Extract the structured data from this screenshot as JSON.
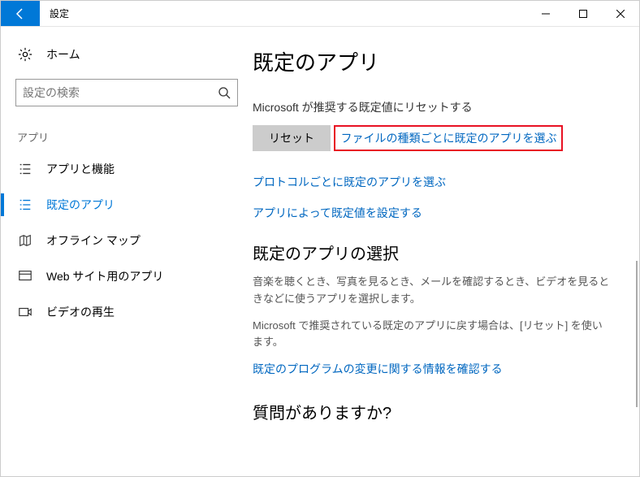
{
  "window": {
    "title": "設定"
  },
  "sidebar": {
    "home": "ホーム",
    "search_placeholder": "設定の検索",
    "section": "アプリ",
    "items": [
      {
        "label": "アプリと機能"
      },
      {
        "label": "既定のアプリ"
      },
      {
        "label": "オフライン マップ"
      },
      {
        "label": "Web サイト用のアプリ"
      },
      {
        "label": "ビデオの再生"
      }
    ]
  },
  "main": {
    "heading": "既定のアプリ",
    "reset_text": "Microsoft が推奨する既定値にリセットする",
    "reset_button": "リセット",
    "links": [
      "ファイルの種類ごとに既定のアプリを選ぶ",
      "プロトコルごとに既定のアプリを選ぶ",
      "アプリによって既定値を設定する"
    ],
    "section2_heading": "既定のアプリの選択",
    "section2_p1": "音楽を聴くとき、写真を見るとき、メールを確認するとき、ビデオを見るときなどに使うアプリを選択します。",
    "section2_p2": "Microsoft で推奨されている既定のアプリに戻す場合は、[リセット] を使います。",
    "section2_link": "既定のプログラムの変更に関する情報を確認する",
    "section3_heading": "質問がありますか?"
  }
}
